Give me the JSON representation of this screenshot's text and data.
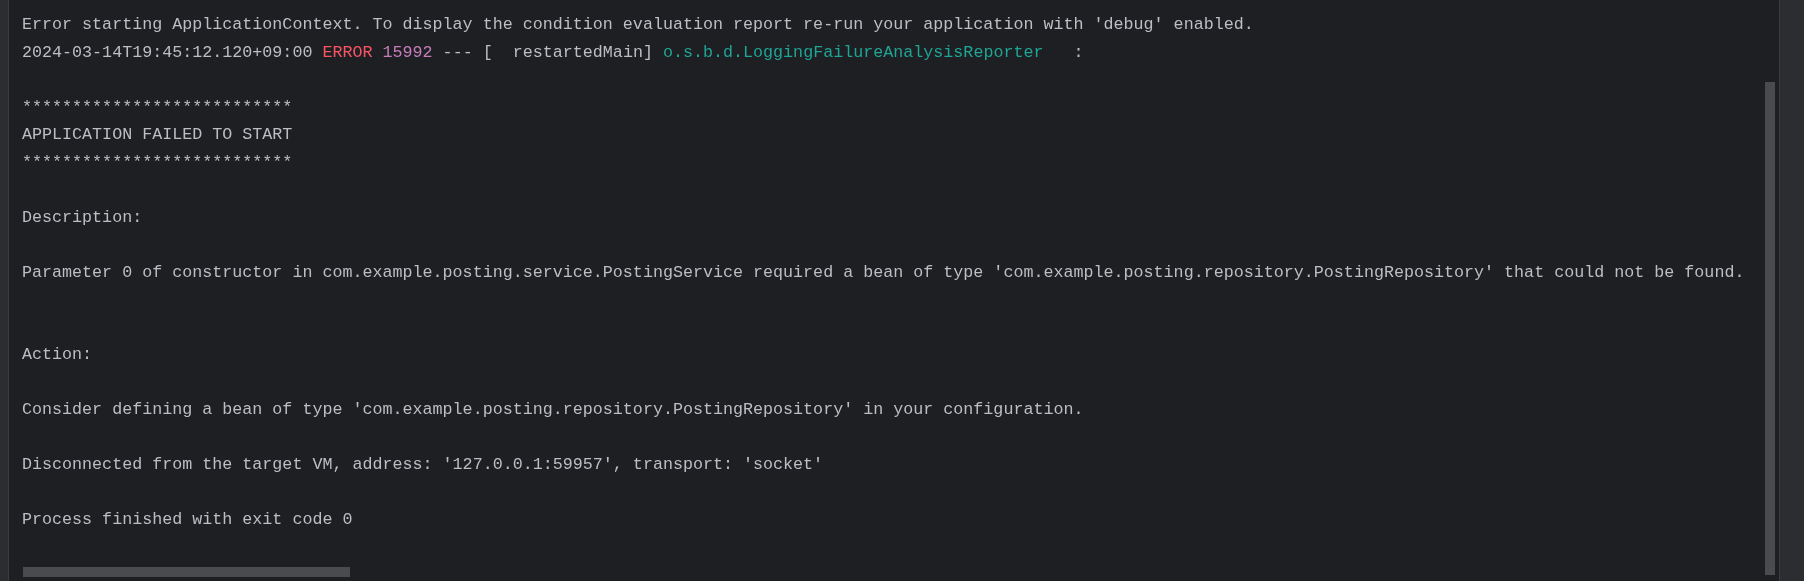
{
  "console": {
    "lines": [
      {
        "kind": "text",
        "segments": [
          {
            "kind": "plain",
            "text": "Error starting ApplicationContext. To display the condition evaluation report re-run your application with 'debug' enabled."
          }
        ]
      },
      {
        "kind": "text",
        "segments": [
          {
            "kind": "plain",
            "text": "2024-03-14T19:45:12.120+09:00 "
          },
          {
            "kind": "level",
            "text": "ERROR "
          },
          {
            "kind": "pid",
            "text": "15992"
          },
          {
            "kind": "plain",
            "text": " --- [  restartedMain] "
          },
          {
            "kind": "logger",
            "text": "o.s.b.d.LoggingFailureAnalysisReporter"
          },
          {
            "kind": "plain",
            "text": "   :"
          }
        ]
      },
      {
        "kind": "blank"
      },
      {
        "kind": "text",
        "segments": [
          {
            "kind": "plain",
            "text": "***************************"
          }
        ]
      },
      {
        "kind": "text",
        "segments": [
          {
            "kind": "plain",
            "text": "APPLICATION FAILED TO START"
          }
        ]
      },
      {
        "kind": "text",
        "segments": [
          {
            "kind": "plain",
            "text": "***************************"
          }
        ]
      },
      {
        "kind": "blank"
      },
      {
        "kind": "text",
        "segments": [
          {
            "kind": "plain",
            "text": "Description:"
          }
        ]
      },
      {
        "kind": "blank"
      },
      {
        "kind": "text",
        "segments": [
          {
            "kind": "plain",
            "text": "Parameter 0 of constructor in com.example.posting.service.PostingService required a bean of type 'com.example.posting.repository.PostingRepository' that could not be found."
          }
        ]
      },
      {
        "kind": "blank"
      },
      {
        "kind": "blank"
      },
      {
        "kind": "text",
        "segments": [
          {
            "kind": "plain",
            "text": "Action:"
          }
        ]
      },
      {
        "kind": "blank"
      },
      {
        "kind": "text",
        "segments": [
          {
            "kind": "plain",
            "text": "Consider defining a bean of type 'com.example.posting.repository.PostingRepository' in your configuration."
          }
        ]
      },
      {
        "kind": "blank"
      },
      {
        "kind": "text",
        "segments": [
          {
            "kind": "plain",
            "text": "Disconnected from the target VM, address: '127.0.0.1:59957', transport: 'socket'"
          }
        ]
      },
      {
        "kind": "blank"
      },
      {
        "kind": "text",
        "segments": [
          {
            "kind": "plain",
            "text": "Process finished with exit code 0"
          }
        ]
      }
    ]
  }
}
